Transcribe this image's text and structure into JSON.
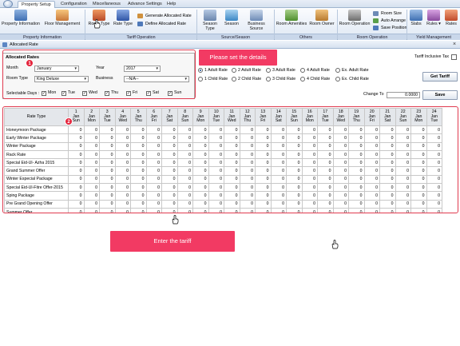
{
  "app": {
    "menu_tabs": [
      "Property Setup",
      "Configuration",
      "Miscellaneous",
      "Advance Settings",
      "Help"
    ],
    "ribbon": {
      "buttons": [
        {
          "label": "Property Information",
          "icon": "building-icon"
        },
        {
          "label": "Floor Management",
          "icon": "house-icon"
        },
        {
          "label": "Room Type",
          "icon": "room-type-icon"
        },
        {
          "label": "Rate Type",
          "icon": "rate-type-icon"
        },
        {
          "label": "Season Type",
          "icon": "season-type-icon"
        },
        {
          "label": "Season",
          "icon": "season-icon"
        },
        {
          "label": "Business Source",
          "icon": "business-source-icon"
        },
        {
          "label": "Room Amenities",
          "icon": "amenities-icon"
        },
        {
          "label": "Room Owner",
          "icon": "room-owner-icon"
        },
        {
          "label": "Room Operation",
          "icon": "room-operation-icon"
        },
        {
          "label": "Slabs",
          "icon": "slabs-icon"
        },
        {
          "label": "Rules ▾",
          "icon": "rules-icon"
        },
        {
          "label": "Rates",
          "icon": "rates-icon"
        }
      ],
      "small_buttons": [
        "Generate Allocated Rate",
        "Define Allocated Rate",
        "Room Size",
        "Auto Arrange",
        "Save Position"
      ],
      "groups": [
        "Property Information",
        "Tariff Operation",
        "Source/Season",
        "Others",
        "Room Operation",
        "Yield Management"
      ]
    },
    "document_title": "Allocated Rate"
  },
  "allocated_rates": {
    "title": "Allocated Rates",
    "month_label": "Month",
    "month_value": "January",
    "year_label": "Year",
    "year_value": "2017",
    "room_type_label": "Room Type",
    "room_type_value": "King Deluxe",
    "business_label": "Business",
    "business_value": "--N/A--",
    "selectable_days_label": "Selectable Days :",
    "days": [
      "Mon",
      "Tue",
      "Wed",
      "Thu",
      "Fri",
      "Sat",
      "Sun"
    ]
  },
  "callouts": {
    "top": "Please set the details",
    "bottom": "Enter the tariff",
    "badge1": "1",
    "badge2": "2"
  },
  "rate_options": {
    "adult": [
      "1 Adult Rate",
      "2 Adult Rate",
      "3 Adult Rate",
      "4 Adult Rate",
      "Ex. Adult Rate"
    ],
    "child": [
      "1 Child Rate",
      "2 Child Rate",
      "3 Child Rate",
      "4 Child Rate",
      "Ex. Child Rate"
    ],
    "selected": "1 Adult Rate",
    "tariff_inclusive_tax": "Tariff Inclusive Tax",
    "get_tariff": "Get Tariff",
    "change_to_label": "Change To",
    "change_to_value": "0.0000",
    "save": "Save"
  },
  "grid": {
    "rate_type_header": "Rate Type",
    "columns": [
      {
        "d": "1",
        "m": "Jan",
        "w": "Sun"
      },
      {
        "d": "2",
        "m": "Jan",
        "w": "Mon"
      },
      {
        "d": "3",
        "m": "Jan",
        "w": "Tue"
      },
      {
        "d": "4",
        "m": "Jan",
        "w": "Wed"
      },
      {
        "d": "5",
        "m": "Jan",
        "w": "Thu"
      },
      {
        "d": "6",
        "m": "Jan",
        "w": "Fri"
      },
      {
        "d": "7",
        "m": "Jan",
        "w": "Sat"
      },
      {
        "d": "8",
        "m": "Jan",
        "w": "Sun"
      },
      {
        "d": "9",
        "m": "Jan",
        "w": "Mon"
      },
      {
        "d": "10",
        "m": "Jan",
        "w": "Tue"
      },
      {
        "d": "11",
        "m": "Jan",
        "w": "Wed"
      },
      {
        "d": "12",
        "m": "Jan",
        "w": "Thu"
      },
      {
        "d": "13",
        "m": "Jan",
        "w": "Fri"
      },
      {
        "d": "14",
        "m": "Jan",
        "w": "Sat"
      },
      {
        "d": "15",
        "m": "Jan",
        "w": "Sun"
      },
      {
        "d": "16",
        "m": "Jan",
        "w": "Mon"
      },
      {
        "d": "17",
        "m": "Jan",
        "w": "Tue"
      },
      {
        "d": "18",
        "m": "Jan",
        "w": "Wed"
      },
      {
        "d": "19",
        "m": "Jan",
        "w": "Thu"
      },
      {
        "d": "20",
        "m": "Jan",
        "w": "Fri"
      },
      {
        "d": "21",
        "m": "Jan",
        "w": "Sat"
      },
      {
        "d": "22",
        "m": "Jan",
        "w": "Sun"
      },
      {
        "d": "23",
        "m": "Jan",
        "w": "Mon"
      },
      {
        "d": "24",
        "m": "Jan",
        "w": "Tue"
      }
    ],
    "rows": [
      "Honeymoon Package",
      "Early Winter Package",
      "Winter Package",
      "Rack Rate",
      "Special Eid-Ul- Azha 2015",
      "Grand Summer Offer",
      "Winter Especial Package",
      "Special Eid-Ul-Fitre Offer-2015",
      "Sping Package",
      "Pre Grand Opening Offer",
      "Summer Offer"
    ],
    "cell_value": "0"
  }
}
